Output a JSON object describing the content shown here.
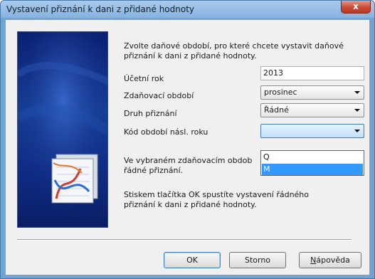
{
  "window": {
    "title": "Vystavení přiznání k dani z přidané hodnoty",
    "close_glyph": "x"
  },
  "intro": {
    "line1": "Zvolte daňové období, pro které chcete vystavit daňové",
    "line2": "přiznání k dani z přidané hodnoty."
  },
  "form": {
    "year_label": "Účetní rok",
    "year_value": "2013",
    "period_label": "Zdaňovací období",
    "period_value": "prosinec",
    "type_label": "Druh přiznání",
    "type_value": "Řádné",
    "code_label": "Kód období násl. roku",
    "code_value": "",
    "code_options": [
      "Q",
      "M"
    ],
    "code_highlighted": "M"
  },
  "info": {
    "line1": "Ve vybraném zdaňovacím obdob",
    "line2": "řádné přiznání."
  },
  "hint": {
    "line1": "Stiskem tlačítka OK spustíte vystavení řádného",
    "line2": "přiznání k dani z přidané hodnoty."
  },
  "buttons": {
    "ok": "OK",
    "cancel": "Storno",
    "help_first": "N",
    "help_rest": "ápověda"
  },
  "icons": {
    "close": "close-icon",
    "dropdown": "chevron-down-icon",
    "banner": "chart-document-icon"
  },
  "colors": {
    "title_bar": "#86b3e0",
    "banner": "#15409a",
    "selection": "#3399ff",
    "close_button": "#c94a36"
  }
}
